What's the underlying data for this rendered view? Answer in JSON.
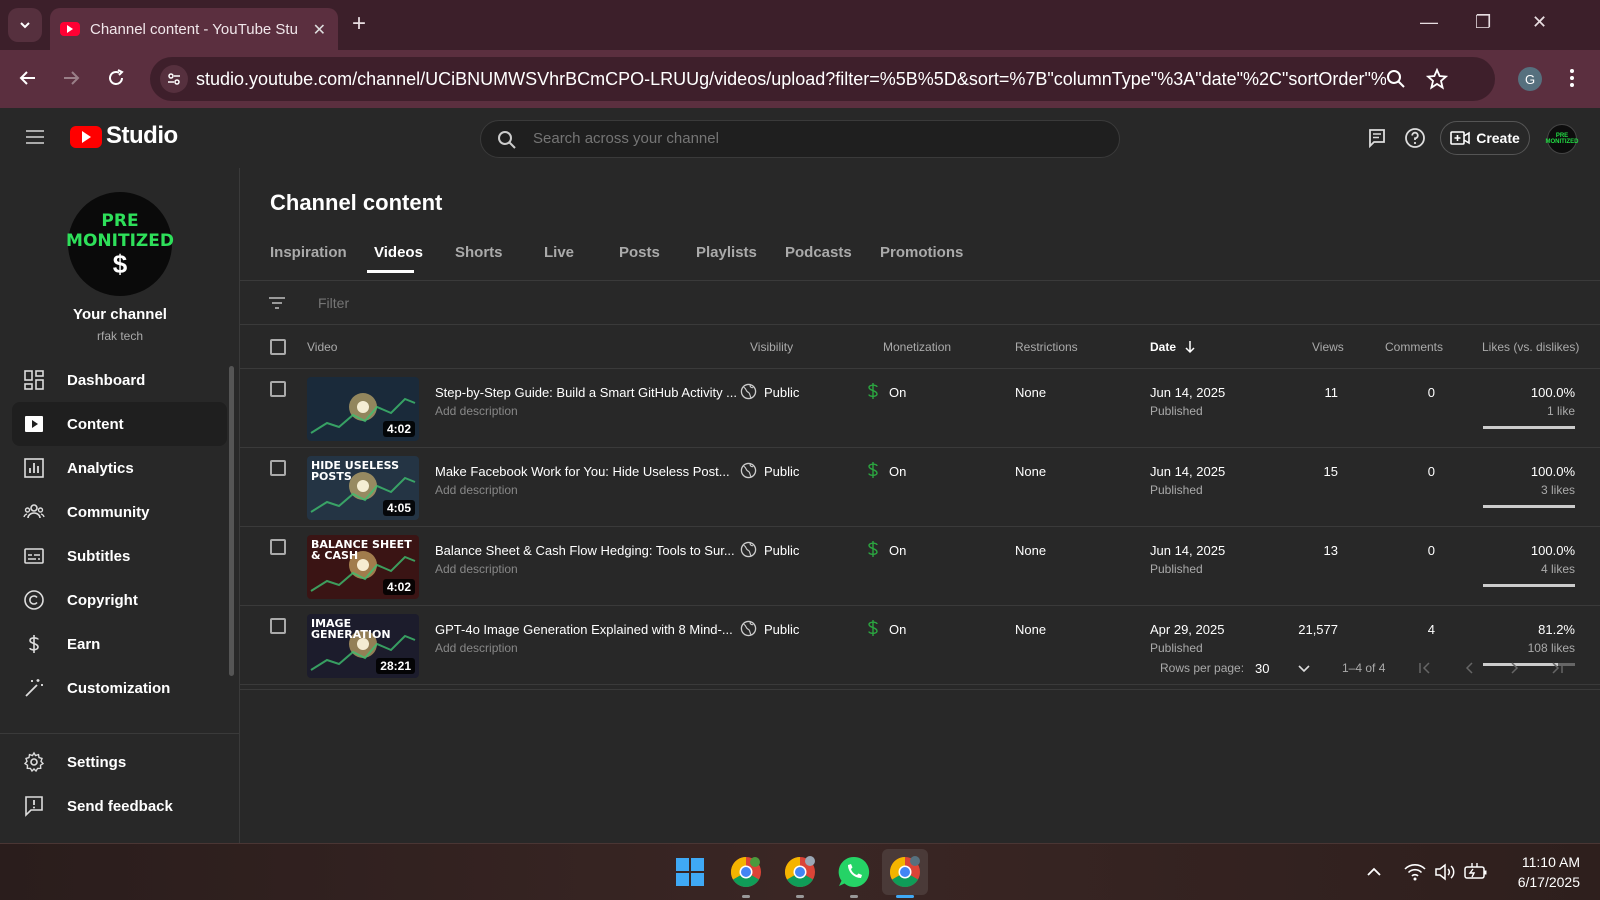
{
  "browser": {
    "tab_title": "Channel content - YouTube Stu",
    "url": "studio.youtube.com/channel/UCiBNUMWSVhrBCmCPO-LRUUg/videos/upload?filter=%5B%5D&sort=%7B\"columnType\"%3A\"date\"%2C\"sortOrder\"%3A\"D...",
    "profile_initial": "G"
  },
  "header": {
    "logo_text": "Studio",
    "search_placeholder": "Search across your channel",
    "create_label": "Create",
    "avatar_text": "PRE MONITIZED"
  },
  "sidebar": {
    "avatar_line1": "PRE",
    "avatar_line2": "MONITIZED",
    "avatar_symbol": "$",
    "channel_label": "Your channel",
    "channel_handle": "rfak tech",
    "items": [
      {
        "label": "Dashboard",
        "icon": "dashboard-icon"
      },
      {
        "label": "Content",
        "icon": "content-icon",
        "active": true
      },
      {
        "label": "Analytics",
        "icon": "analytics-icon"
      },
      {
        "label": "Community",
        "icon": "community-icon"
      },
      {
        "label": "Subtitles",
        "icon": "subtitles-icon"
      },
      {
        "label": "Copyright",
        "icon": "copyright-icon"
      },
      {
        "label": "Earn",
        "icon": "earn-icon"
      },
      {
        "label": "Customization",
        "icon": "customization-icon"
      }
    ],
    "bottom_items": [
      {
        "label": "Settings",
        "icon": "settings-icon"
      },
      {
        "label": "Send feedback",
        "icon": "feedback-icon"
      }
    ]
  },
  "main": {
    "title": "Channel content",
    "tabs": [
      "Inspiration",
      "Videos",
      "Shorts",
      "Live",
      "Posts",
      "Playlists",
      "Podcasts",
      "Promotions"
    ],
    "active_tab": "Videos",
    "filter_placeholder": "Filter",
    "columns": {
      "video": "Video",
      "visibility": "Visibility",
      "monetization": "Monetization",
      "restrictions": "Restrictions",
      "date": "Date",
      "views": "Views",
      "comments": "Comments",
      "likes": "Likes (vs. dislikes)"
    },
    "rows": [
      {
        "title": "Step-by-Step Guide: Build a Smart GitHub Activity ...",
        "description": "Add description",
        "duration": "4:02",
        "visibility": "Public",
        "monetization": "On",
        "restrictions": "None",
        "date": "Jun 14, 2025",
        "date_status": "Published",
        "views": "11",
        "comments": "0",
        "likes_pct": "100.0%",
        "likes_count": "1 like",
        "likes_ratio": 1.0,
        "thumb_color": "#1a2a3a",
        "thumb_text": ""
      },
      {
        "title": "Make Facebook Work for You: Hide Useless Post...",
        "description": "Add description",
        "duration": "4:05",
        "visibility": "Public",
        "monetization": "On",
        "restrictions": "None",
        "date": "Jun 14, 2025",
        "date_status": "Published",
        "views": "15",
        "comments": "0",
        "likes_pct": "100.0%",
        "likes_count": "3 likes",
        "likes_ratio": 1.0,
        "thumb_color": "#243444",
        "thumb_text": "HIDE USELESS POSTS"
      },
      {
        "title": "Balance Sheet & Cash Flow Hedging: Tools to Sur...",
        "description": "Add description",
        "duration": "4:02",
        "visibility": "Public",
        "monetization": "On",
        "restrictions": "None",
        "date": "Jun 14, 2025",
        "date_status": "Published",
        "views": "13",
        "comments": "0",
        "likes_pct": "100.0%",
        "likes_count": "4 likes",
        "likes_ratio": 1.0,
        "thumb_color": "#3a1414",
        "thumb_text": "BALANCE SHEET & CASH"
      },
      {
        "title": "GPT-4o Image Generation Explained with 8 Mind-...",
        "description": "Add description",
        "duration": "28:21",
        "visibility": "Public",
        "monetization": "On",
        "restrictions": "None",
        "date": "Apr 29, 2025",
        "date_status": "Published",
        "views": "21,577",
        "comments": "4",
        "likes_pct": "81.2%",
        "likes_count": "108 likes",
        "likes_ratio": 0.812,
        "thumb_color": "#1c1c2c",
        "thumb_text": "IMAGE GENERATION"
      }
    ],
    "pagination": {
      "rows_per_page_label": "Rows per page:",
      "rows_per_page": "30",
      "range": "1–4 of 4"
    }
  },
  "taskbar": {
    "time": "11:10 AM",
    "date": "6/17/2025"
  },
  "colors": {
    "brand_red": "#ff0000",
    "monetization_green": "#2ba640",
    "tab_strip": "#3c1f2a",
    "toolbar": "#5b2f3f"
  }
}
